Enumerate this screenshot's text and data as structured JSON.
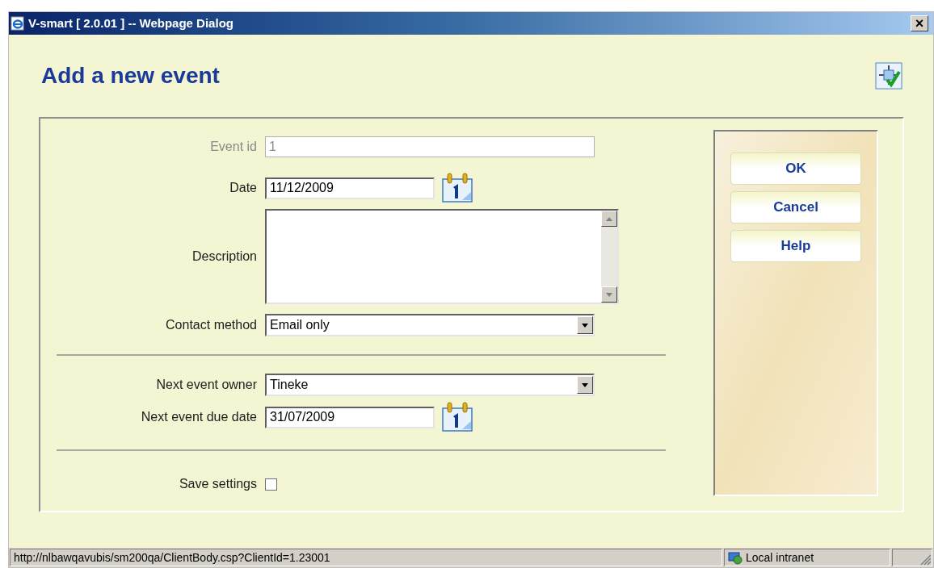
{
  "window": {
    "title": "V-smart [ 2.0.01 ] -- Webpage Dialog",
    "close": "×"
  },
  "heading": "Add a new event",
  "form": {
    "sections": [
      [
        {
          "kind": "text",
          "label": "Event id",
          "value": "1",
          "disabled": true
        },
        {
          "kind": "date",
          "label": "Date",
          "value": "11/12/2009"
        },
        {
          "kind": "textarea",
          "label": "Description"
        },
        {
          "kind": "select",
          "label": "Contact method",
          "value": "Email only"
        }
      ],
      [
        {
          "kind": "select",
          "label": "Next event owner",
          "value": "Tineke"
        },
        {
          "kind": "date",
          "label": "Next event due date",
          "value": "31/07/2009"
        }
      ],
      [
        {
          "kind": "checkbox",
          "label": "Save settings",
          "checked": false
        }
      ]
    ]
  },
  "buttons": [
    "OK",
    "Cancel",
    "Help"
  ],
  "status_bar": {
    "url": "http://nlbawqavubis/sm200qa/ClientBody.csp?ClientId=1.23001",
    "zone": "Local intranet"
  }
}
